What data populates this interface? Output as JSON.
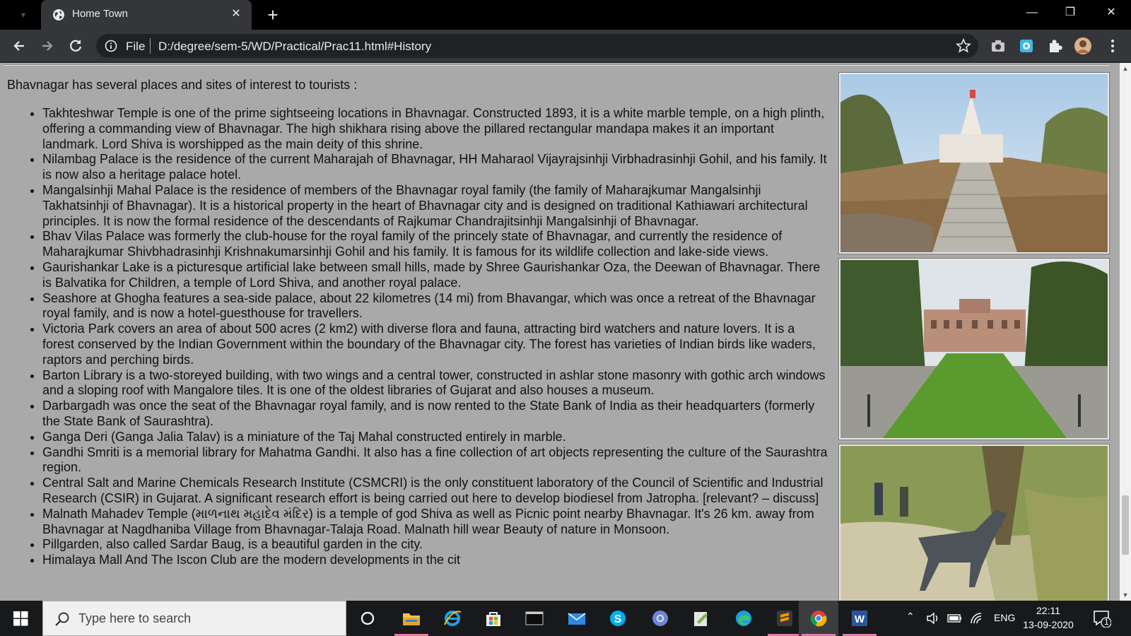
{
  "tab": {
    "title": "Home Town",
    "close": "✕"
  },
  "new_tab": "+",
  "window_controls": {
    "minimize": "—",
    "maximize": "❐",
    "close": "✕"
  },
  "address_bar": {
    "scheme_label": "File",
    "url": "D:/degree/sem-5/WD/Practical/Prac11.html#History"
  },
  "page": {
    "intro": "Bhavnagar has several places and sites of interest to tourists :",
    "places": [
      "Takhteshwar Temple is one of the prime sightseeing locations in Bhavnagar. Constructed 1893, it is a white marble temple, on a high plinth, offering a commanding view of Bhavnagar. The high shikhara rising above the pillared rectangular mandapa makes it an important landmark. Lord Shiva is worshipped as the main deity of this shrine.",
      "Nilambag Palace is the residence of the current Maharajah of Bhavnagar, HH Maharaol Vijayrajsinhji Virbhadrasinhji Gohil, and his family. It is now also a heritage palace hotel.",
      "Mangalsinhji Mahal Palace is the residence of members of the Bhavnagar royal family (the family of Maharajkumar Mangalsinhji Takhatsinhji of Bhavnagar). It is a historical property in the heart of Bhavnagar city and is designed on traditional Kathiawari architectural principles. It is now the formal residence of the descendants of Rajkumar Chandrajitsinhji Mangalsinhji of Bhavnagar.",
      "Bhav Vilas Palace was formerly the club-house for the royal family of the princely state of Bhavnagar, and currently the residence of Maharajkumar Shivbhadrasinhji Krishnakumarsinhji Gohil and his family. It is famous for its wildlife collection and lake-side views.",
      "Gaurishankar Lake is a picturesque artificial lake between small hills, made by Shree Gaurishankar Oza, the Deewan of Bhavnagar. There is Balvatika for Children, a temple of Lord Shiva, and another royal palace.",
      "Seashore at Ghogha features a sea-side palace, about 22 kilometres (14 mi) from Bhavangar, which was once a retreat of the Bhavnagar royal family, and is now a hotel-guesthouse for travellers.",
      "Victoria Park covers an area of about 500 acres (2 km2) with diverse flora and fauna, attracting bird watchers and nature lovers. It is a forest conserved by the Indian Government within the boundary of the Bhavnagar city. The forest has varieties of Indian birds like waders, raptors and perching birds.",
      "Barton Library is a two-storeyed building, with two wings and a central tower, constructed in ashlar stone masonry with gothic arch windows and a sloping roof with Mangalore tiles. It is one of the oldest libraries of Gujarat and also houses a museum.",
      "Darbargadh was once the seat of the Bhavnagar royal family, and is now rented to the State Bank of India as their headquarters (formerly the State Bank of Saurashtra).",
      "Ganga Deri (Ganga Jalia Talav) is a miniature of the Taj Mahal constructed entirely in marble.",
      "Gandhi Smriti is a memorial library for Mahatma Gandhi. It also has a fine collection of art objects representing the culture of the Saurashtra region.",
      "Central Salt and Marine Chemicals Research Institute (CSMCRI) is the only constituent laboratory of the Council of Scientific and Industrial Research (CSIR) in Gujarat. A significant research effort is being carried out here to develop biodiesel from Jatropha. [relevant? – discuss]",
      "Malnath Mahadev Temple (માળનાથ મહાદેવ મંદિર) is a temple of god Shiva as well as Picnic point nearby Bhavnagar. It's 26 km. away from Bhavnagar at Nagdhaniba Village from Bhavnagar-Talaja Road. Malnath hill wear Beauty of nature in Monsoon.",
      "Pillgarden, also called Sardar Baug, is a beautiful garden in the city.",
      "Himalaya Mall And The Iscon Club are the modern developments in the cit"
    ]
  },
  "taskbar": {
    "search_placeholder": "Type here to search",
    "language": "ENG",
    "time": "22:11",
    "date": "13-09-2020",
    "notification_count": "1"
  }
}
